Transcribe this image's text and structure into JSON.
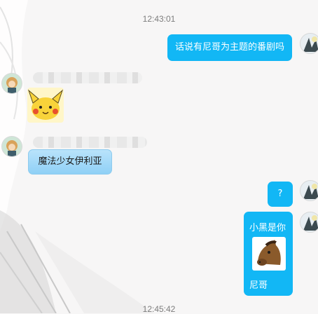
{
  "timestamps": {
    "top": "12:43:01",
    "bottom": "12:45:42"
  },
  "messages": {
    "m1_text": "话说有尼哥为主题的番剧吗",
    "m4_text": "魔法少女伊利亚",
    "m5_text": "?",
    "m6_line1": "小黑是你",
    "m6_line2": "尼哥"
  },
  "colors": {
    "outgoing_bubble": "#12b7f5",
    "incoming_bubble": "#9fd6f8",
    "timestamp_text": "#7d7d7d"
  },
  "icons": {
    "sticker_pikachu": "pikachu-sticker-icon",
    "sticker_horse": "horse-emoji-icon",
    "avatar_self": "user-avatar-icon",
    "avatar_other": "contact-avatar-icon"
  }
}
